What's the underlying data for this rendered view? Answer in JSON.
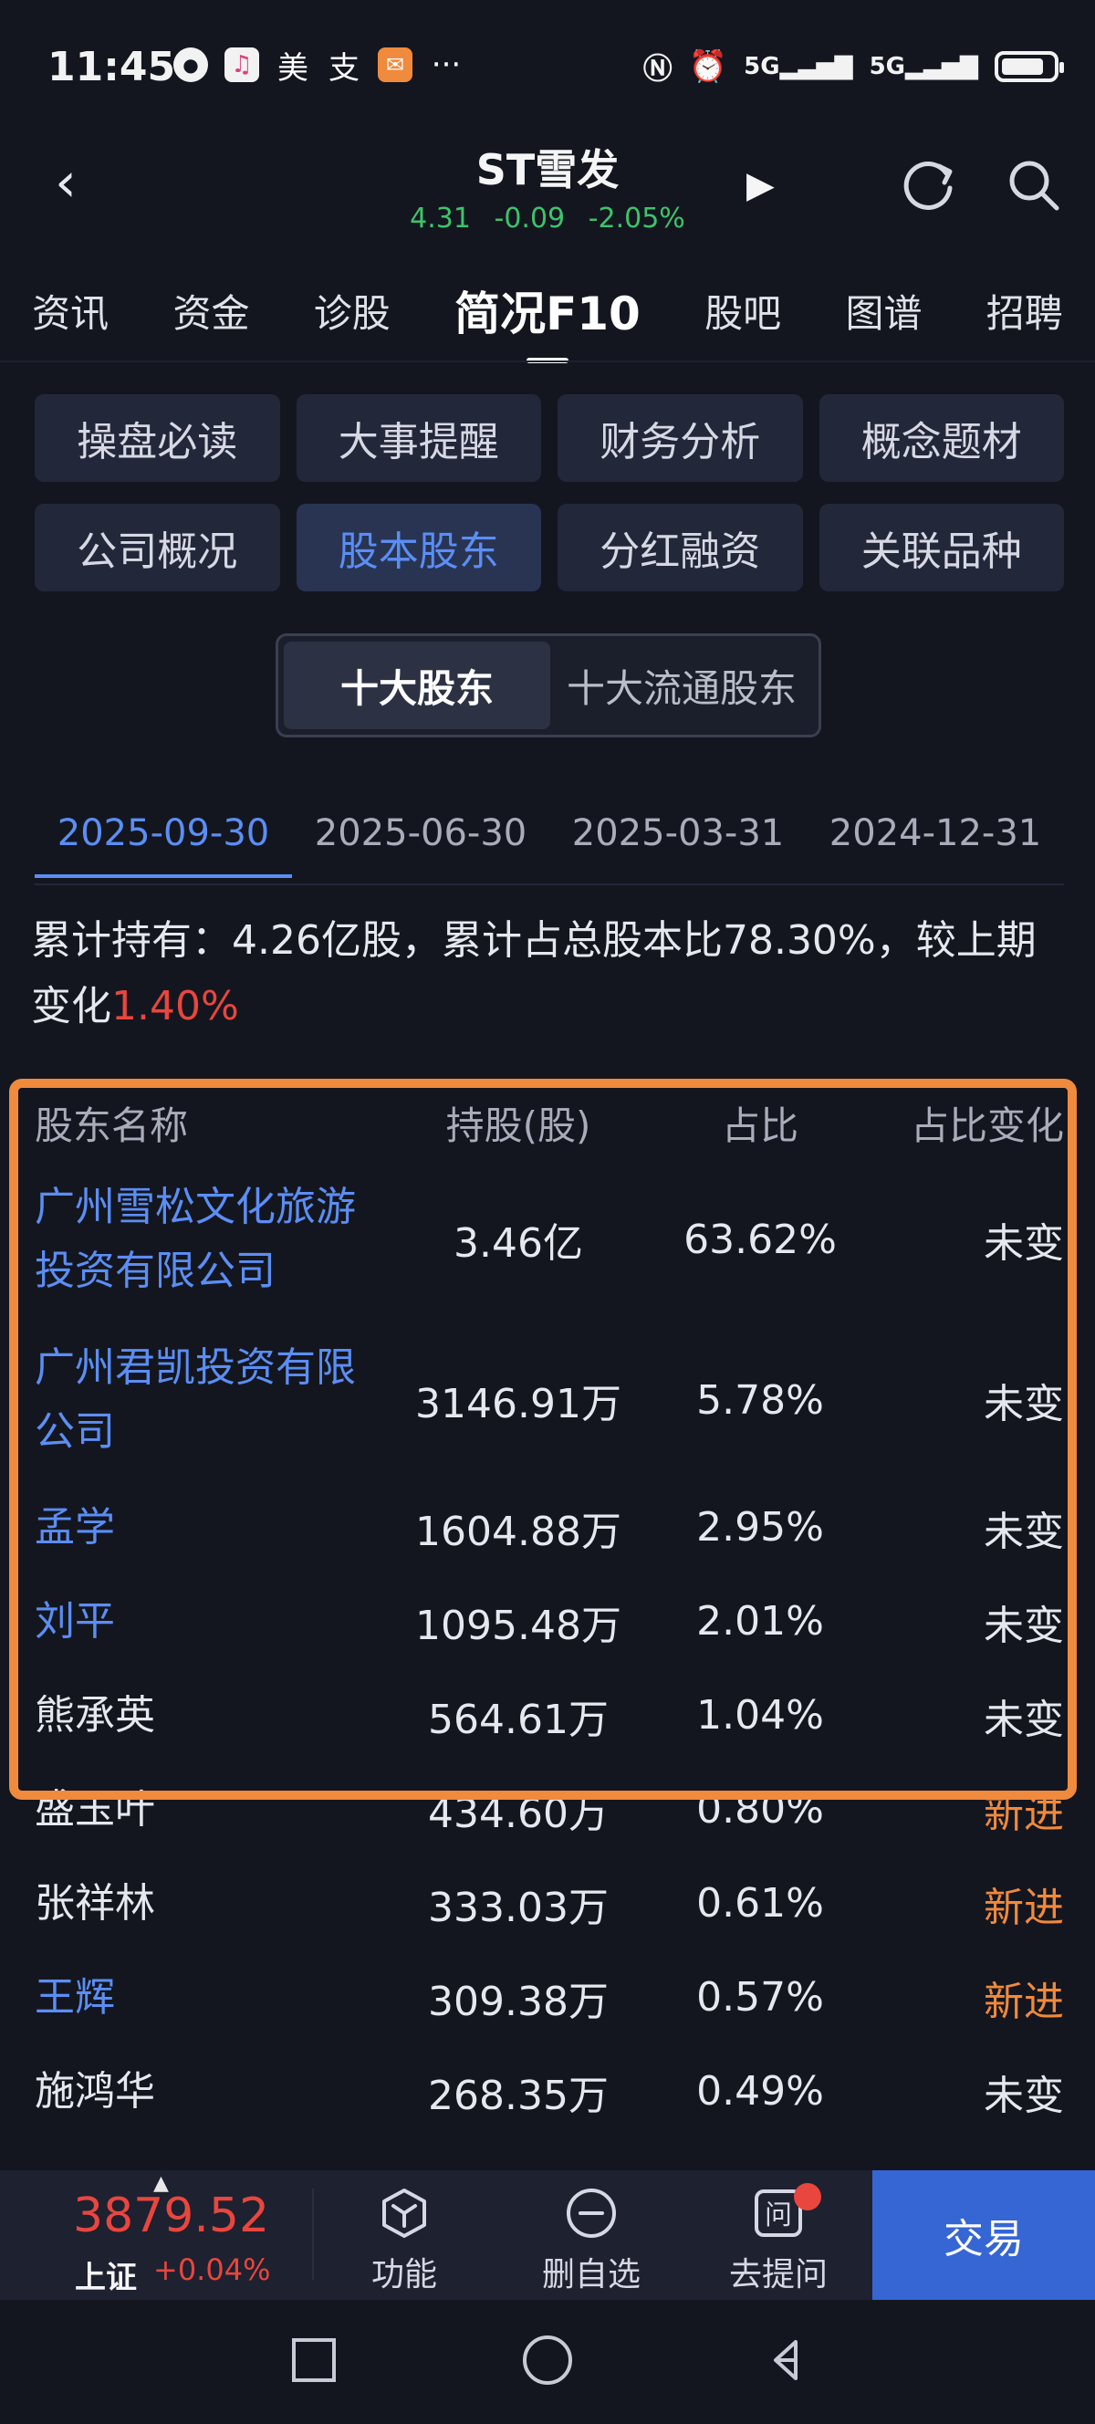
{
  "status_bar": {
    "time": "11:45",
    "icons_left": [
      "chat-bubble-icon",
      "music-app-icon",
      "meituan-text-icon",
      "alipay-text-icon",
      "red-envelope-icon",
      "more-dots-icon"
    ],
    "signal_1": "5G",
    "signal_2": "5G",
    "more": "···"
  },
  "header": {
    "title": "ST雪发",
    "price": "4.31",
    "change": "-0.09",
    "change_pct": "-2.05%"
  },
  "main_tabs": [
    "资讯",
    "资金",
    "诊股",
    "简况F10",
    "股吧",
    "图谱",
    "招聘"
  ],
  "main_tabs_active": 3,
  "sub_tabs": [
    "操盘必读",
    "大事提醒",
    "财务分析",
    "概念题材",
    "公司概况",
    "股本股东",
    "分红融资",
    "关联品种"
  ],
  "sub_tabs_active": 5,
  "segments": [
    "十大股东",
    "十大流通股东"
  ],
  "segments_active": 0,
  "dates": [
    "2025-09-30",
    "2025-06-30",
    "2025-03-31",
    "2024-12-31"
  ],
  "dates_active": 0,
  "summary": {
    "text": "累计持有：4.26亿股，累计占总股本比78.30%，较上期变化",
    "change": "1.40%"
  },
  "table": {
    "headers": [
      "股东名称",
      "持股(股)",
      "占比",
      "占比变化"
    ],
    "rows": [
      {
        "name": "广州雪松文化旅游投资有限公司",
        "shares": "3.46亿",
        "ratio": "63.62%",
        "change": "未变",
        "link": true,
        "new": false
      },
      {
        "name": "广州君凯投资有限公司",
        "shares": "3146.91万",
        "ratio": "5.78%",
        "change": "未变",
        "link": true,
        "new": false
      },
      {
        "name": "孟学",
        "shares": "1604.88万",
        "ratio": "2.95%",
        "change": "未变",
        "link": true,
        "new": false
      },
      {
        "name": "刘平",
        "shares": "1095.48万",
        "ratio": "2.01%",
        "change": "未变",
        "link": true,
        "new": false
      },
      {
        "name": "熊承英",
        "shares": "564.61万",
        "ratio": "1.04%",
        "change": "未变",
        "link": false,
        "new": false
      },
      {
        "name": "盛玉叶",
        "shares": "434.60万",
        "ratio": "0.80%",
        "change": "新进",
        "link": false,
        "new": true
      },
      {
        "name": "张祥林",
        "shares": "333.03万",
        "ratio": "0.61%",
        "change": "新进",
        "link": false,
        "new": true
      },
      {
        "name": "王辉",
        "shares": "309.38万",
        "ratio": "0.57%",
        "change": "新进",
        "link": true,
        "new": true
      },
      {
        "name": "施鸿华",
        "shares": "268.35万",
        "ratio": "0.49%",
        "change": "未变",
        "link": false,
        "new": false
      }
    ]
  },
  "bottom_bar": {
    "index_value": "3879.52",
    "index_name": "上证",
    "index_change": "+0.04%",
    "items": [
      {
        "label": "功能",
        "icon": "hexagon-function-icon"
      },
      {
        "label": "删自选",
        "icon": "remove-circle-icon"
      },
      {
        "label": "去提问",
        "icon": "ask-question-icon"
      }
    ],
    "trade": "交易"
  },
  "colors": {
    "background": "#14161f",
    "accent_blue": "#5b8ef4",
    "down_green": "#3cc46a",
    "up_red": "#e8463e",
    "orange": "#f08a3c",
    "trade_blue": "#3566d4"
  }
}
